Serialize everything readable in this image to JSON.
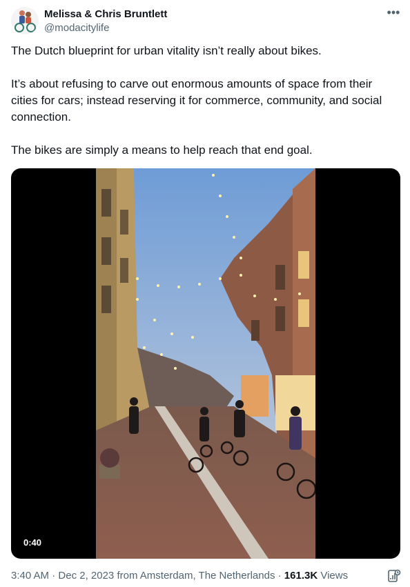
{
  "author": {
    "name": "Melissa & Chris Bruntlett",
    "handle": "@modacitylife"
  },
  "tweet": {
    "paragraphs": [
      "The Dutch blueprint for urban vitality isn’t really about bikes.",
      "It’s about refusing to carve out enormous amounts of space from their cities for cars; instead reserving it for commerce, community, and social connection.",
      "The bikes are simply a means to help reach that end goal."
    ]
  },
  "video": {
    "duration": "0:40"
  },
  "meta": {
    "time": "3:40 AM",
    "date": "Dec 2, 2023",
    "from_prefix": "from",
    "location": "Amsterdam, The Netherlands",
    "views_count": "161.3K",
    "views_label": "Views"
  },
  "icons": {
    "more": "more-icon",
    "analytics": "analytics-icon"
  }
}
